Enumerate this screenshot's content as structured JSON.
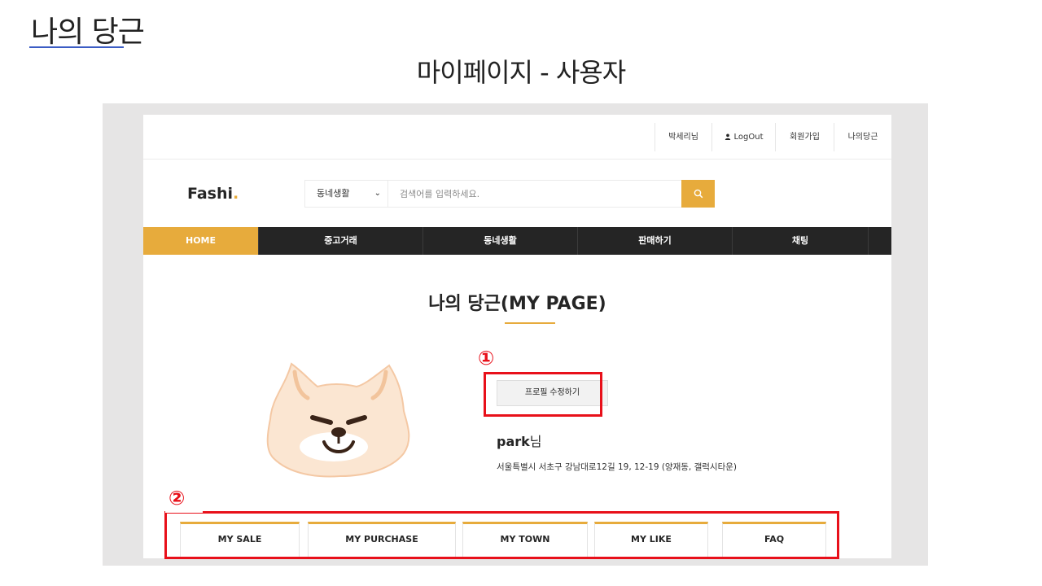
{
  "slide": {
    "title": "나의 당근",
    "subtitle": "마이페이지 - 사용자"
  },
  "topbar": {
    "user_name": "박세리님",
    "logout_label": "LogOut",
    "signup_label": "회원가입",
    "mypage_label": "나의당근"
  },
  "header": {
    "logo_text": "Fashi",
    "logo_dot": ".",
    "category_selected": "동네생활",
    "search_placeholder": "검색어를 입력하세요.",
    "search_icon": "search-icon"
  },
  "nav": {
    "items": [
      {
        "label": "HOME",
        "active": true
      },
      {
        "label": "중고거래",
        "active": false
      },
      {
        "label": "동네생활",
        "active": false
      },
      {
        "label": "판매하기",
        "active": false
      },
      {
        "label": "채팅",
        "active": false
      }
    ]
  },
  "mypage": {
    "title": "나의 당근(MY PAGE)",
    "edit_profile_label": "프로필 수정하기",
    "username": "park",
    "username_suffix": "님",
    "address": "서울특별시 서초구 강남대로12길 19, 12-19 (양재동, 갤럭시타운)",
    "tabs": [
      "MY SALE",
      "MY PURCHASE",
      "MY TOWN",
      "MY LIKE",
      "FAQ"
    ]
  },
  "annotations": {
    "marker_1": "①",
    "marker_2": "②"
  },
  "colors": {
    "accent": "#e7ab3c",
    "nav_bg": "#252525",
    "annotation_red": "#e8101a",
    "title_underline": "#3b5cc4"
  }
}
